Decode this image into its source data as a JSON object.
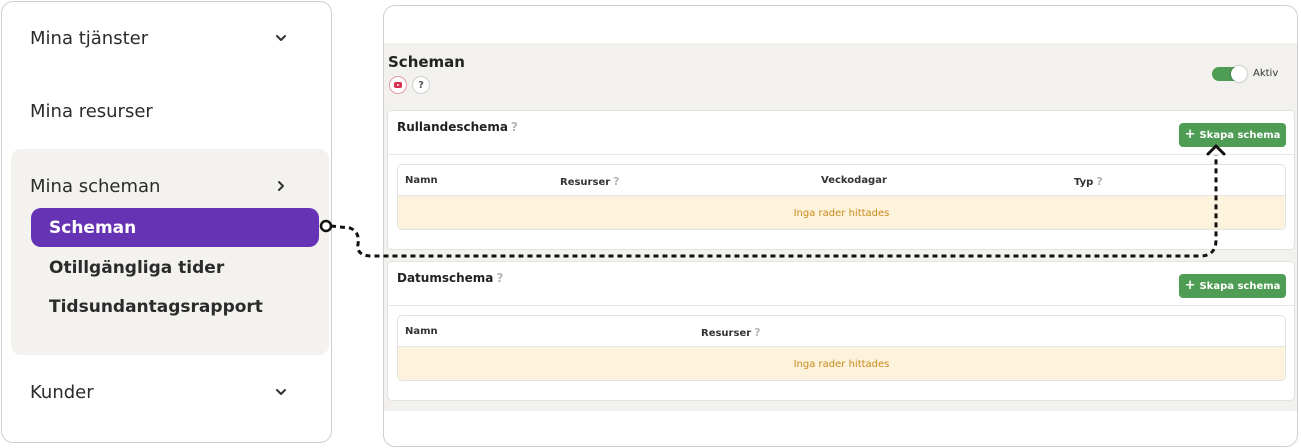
{
  "sidebar": {
    "items": [
      {
        "label": "Mina tjänster"
      },
      {
        "label": "Mina resurser"
      },
      {
        "label": "Mina scheman"
      },
      {
        "label": "Kunder"
      }
    ],
    "sub_items": [
      {
        "label": "Scheman"
      },
      {
        "label": "Otillgängliga tider"
      },
      {
        "label": "Tidsundantagsrapport"
      }
    ]
  },
  "page": {
    "title": "Scheman",
    "help_label": "?",
    "toggle_label": "Aktiv"
  },
  "rolling": {
    "title": "Rullandeschema",
    "help": "?",
    "button_label": "Skapa schema",
    "columns": [
      "Namn",
      "Resurser",
      "Veckodagar",
      "Typ"
    ],
    "empty_text": "Inga rader hittades"
  },
  "date": {
    "title": "Datumschema",
    "help": "?",
    "button_label": "Skapa schema",
    "columns": [
      "Namn",
      "Resurser"
    ],
    "empty_text": "Inga rader hittades"
  },
  "colors": {
    "accent": "#6633b4",
    "button": "#4f9c55",
    "empty_bg": "#fdf2dc"
  }
}
